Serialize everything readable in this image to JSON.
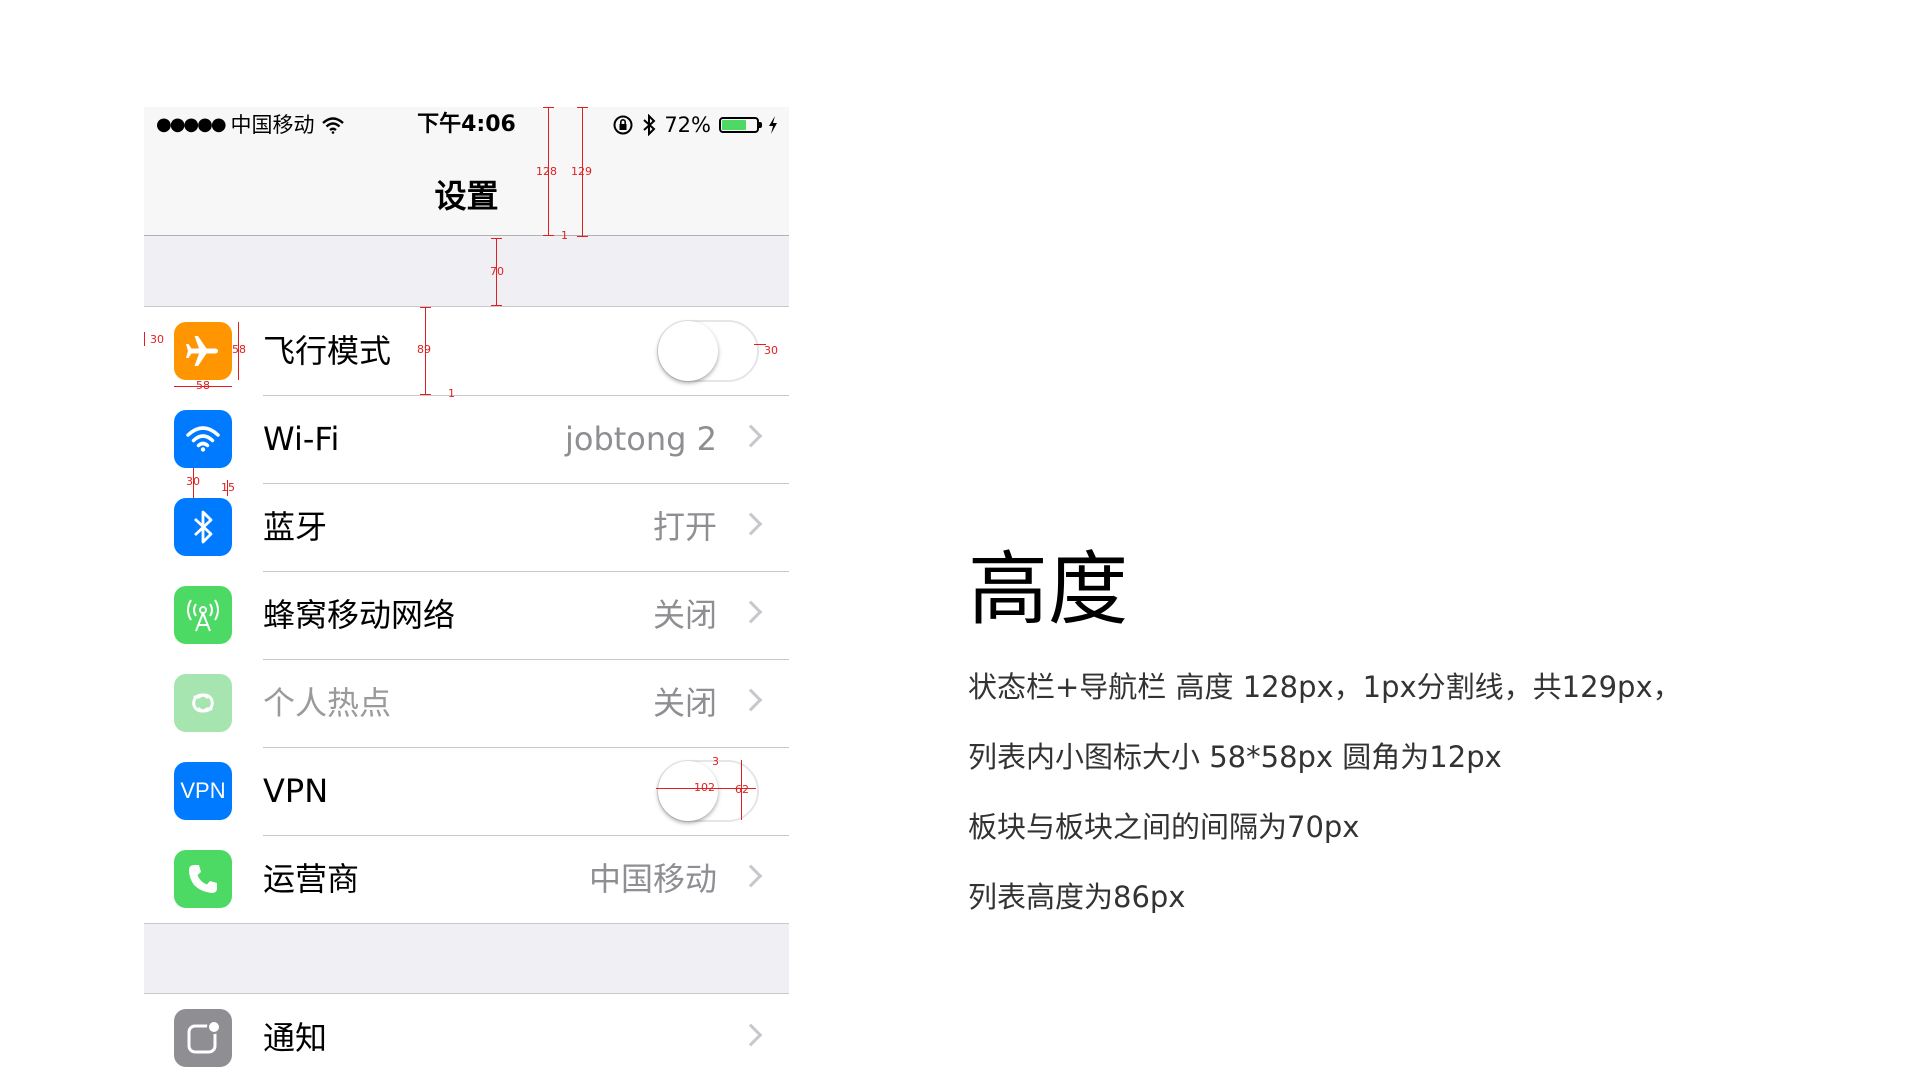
{
  "status_bar": {
    "signal": "●●●●●",
    "carrier": "中国移动",
    "time": "下午4:06",
    "battery_pct": "72%",
    "battery_level": 0.72
  },
  "nav": {
    "title": "设置"
  },
  "group1": [
    {
      "label": "飞行模式",
      "icon": "airplane-icon",
      "icon_color": "#ff9500",
      "control": "toggle",
      "toggle_on": false
    },
    {
      "label": "Wi-Fi",
      "icon": "wifi-icon",
      "icon_color": "#007aff",
      "value": "jobtong 2"
    },
    {
      "label": "蓝牙",
      "icon": "bluetooth-icon",
      "icon_color": "#007aff",
      "value": "打开"
    },
    {
      "label": "蜂窝移动网络",
      "icon": "cellular-antenna-icon",
      "icon_color": "#4cd964",
      "value": "关闭"
    },
    {
      "label": "个人热点",
      "icon": "hotspot-link-icon",
      "icon_color": "#a6e4b0",
      "value": "关闭",
      "disabled": true
    },
    {
      "label": "VPN",
      "icon": "vpn-icon",
      "icon_text": "VPN",
      "icon_color": "#007aff",
      "control": "toggle",
      "toggle_on": false
    },
    {
      "label": "运营商",
      "icon": "phone-icon",
      "icon_color": "#4cd964",
      "value": "中国移动"
    }
  ],
  "group2": [
    {
      "label": "通知",
      "icon": "notification-icon",
      "icon_color": "#8e8e93"
    }
  ],
  "annotations": {
    "header_height": "128",
    "header_total": "129",
    "divider": "1",
    "section_gap": "70",
    "row_height": "89",
    "row_divider": "1",
    "left_margin": "30",
    "icon_w": "58",
    "icon_h": "58",
    "right_margin": "30",
    "icon_gap": "30",
    "icon_top": "15",
    "toggle_w": "102",
    "toggle_h": "62",
    "toggle_pad": "3"
  },
  "panel": {
    "title": "高度",
    "notes": [
      "状态栏+导航栏 高度 128px，1px分割线，共129px，",
      "列表内小图标大小 58*58px 圆角为12px",
      "板块与板块之间的间隔为70px",
      "列表高度为86px"
    ]
  }
}
